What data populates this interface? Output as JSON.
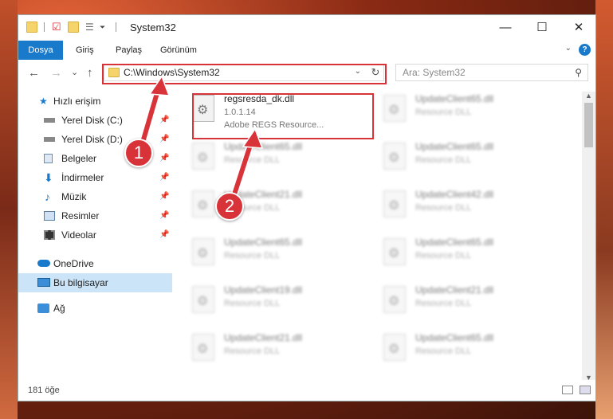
{
  "window": {
    "title": "System32",
    "minimize_label": "—",
    "maximize_label": "☐",
    "close_label": "✕"
  },
  "ribbon": {
    "tabs": [
      "Dosya",
      "Giriş",
      "Paylaş",
      "Görünüm"
    ],
    "help_label": "?"
  },
  "nav": {
    "back_label": "←",
    "forward_label": "→",
    "recent_label": "⌄",
    "up_label": "↑",
    "address": "C:\\Windows\\System32",
    "search_placeholder": "Ara: System32",
    "refresh_label": "↻"
  },
  "sidebar": {
    "items": [
      {
        "label": "Hızlı erişim",
        "icon": "star-icon"
      },
      {
        "label": "Yerel Disk (C:)",
        "icon": "drive-icon"
      },
      {
        "label": "Yerel Disk (D:)",
        "icon": "drive-icon"
      },
      {
        "label": "Belgeler",
        "icon": "documents-icon"
      },
      {
        "label": "İndirmeler",
        "icon": "download-icon"
      },
      {
        "label": "Müzik",
        "icon": "music-icon"
      },
      {
        "label": "Resimler",
        "icon": "pictures-icon"
      },
      {
        "label": "Videolar",
        "icon": "videos-icon"
      },
      {
        "label": "OneDrive",
        "icon": "cloud-icon"
      },
      {
        "label": "Bu bilgisayar",
        "icon": "computer-icon"
      },
      {
        "label": "Ağ",
        "icon": "network-icon"
      }
    ]
  },
  "files": {
    "main": {
      "name": "regsresda_dk.dll",
      "version": "1.0.1.14",
      "description": "Adobe REGS Resource..."
    },
    "blurred": [
      {
        "name": "UpdateClient65.dll",
        "desc": "Resource DLL"
      },
      {
        "name": "UpdateClient65.dll",
        "desc": "Resource DLL"
      },
      {
        "name": "UpdateClient65.dll",
        "desc": "Resource DLL"
      },
      {
        "name": "UpdateClient21.dll",
        "desc": "Resource DLL"
      },
      {
        "name": "UpdateClient42.dll",
        "desc": "Resource DLL"
      },
      {
        "name": "UpdateClient65.dll",
        "desc": "Resource DLL"
      },
      {
        "name": "UpdateClient65.dll",
        "desc": "Resource DLL"
      },
      {
        "name": "UpdateClient19.dll",
        "desc": "Resource DLL"
      },
      {
        "name": "UpdateClient21.dll",
        "desc": "Resource DLL"
      },
      {
        "name": "UpdateClient21.dll",
        "desc": "Resource DLL"
      },
      {
        "name": "UpdateClient65.dll",
        "desc": "Resource DLL"
      }
    ]
  },
  "status": {
    "count": "181 öğe"
  },
  "annotations": {
    "step1": "1",
    "step2": "2"
  },
  "colors": {
    "highlight": "#d9333a",
    "accent": "#1979ca"
  }
}
